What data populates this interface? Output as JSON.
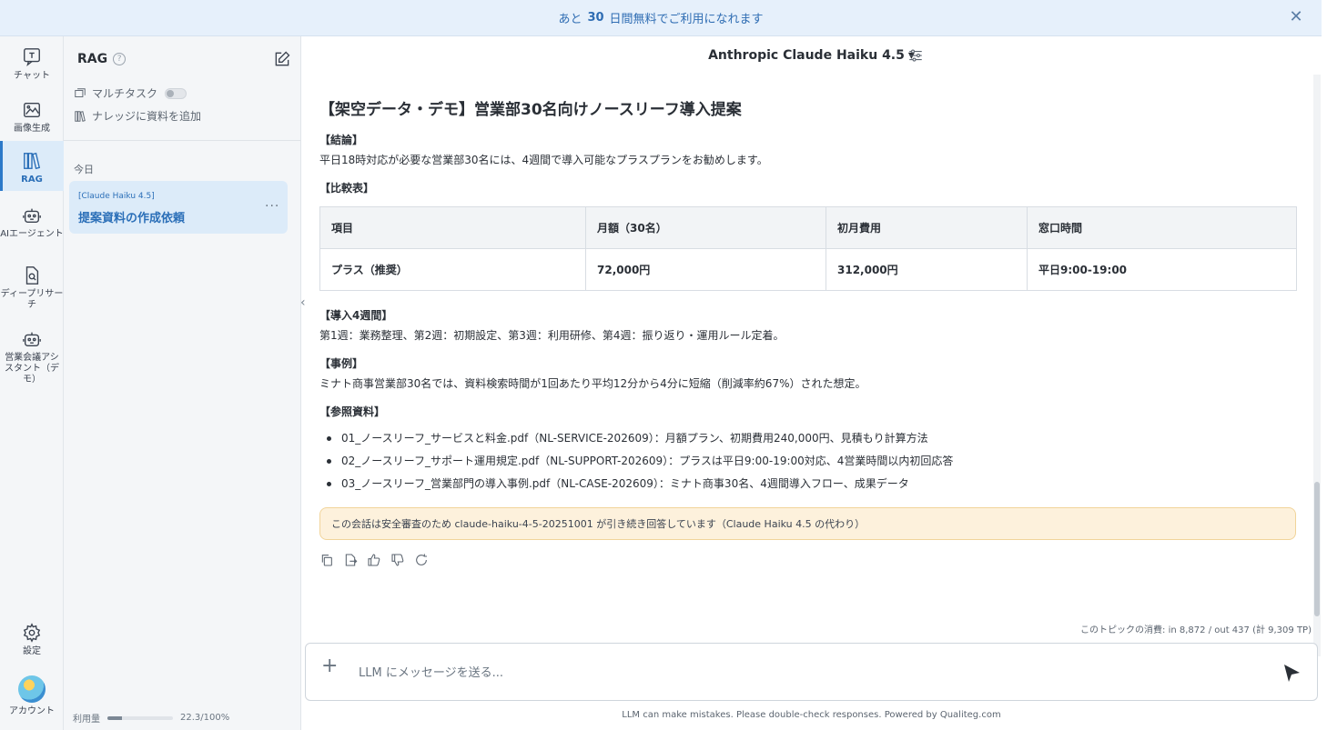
{
  "banner": {
    "prefix": "あと",
    "days": "30",
    "suffix": "日間無料でご利用になれます",
    "close": "✕"
  },
  "rail": {
    "items": [
      {
        "label": "チャット"
      },
      {
        "label": "画像生成"
      },
      {
        "label": "RAG"
      },
      {
        "label": "AIエージェント"
      },
      {
        "label": "ディープリサーチ"
      },
      {
        "label": "営業会議アシスタント（デモ）"
      },
      {
        "label": "設定"
      },
      {
        "label": "アカウント"
      }
    ]
  },
  "sidebar": {
    "title": "RAG",
    "help": "?",
    "multitask_label": "マルチタスク",
    "knowledge_label": "ナレッジに資料を追加",
    "section_today": "今日",
    "conversation": {
      "model": "[Claude Haiku 4.5]",
      "title": "提案資料の作成依頼",
      "more": "···"
    },
    "usage": {
      "label": "利用量",
      "value": "22.3/100%",
      "percent": 22.3
    }
  },
  "main": {
    "model": "Anthropic Claude Haiku 4.5",
    "model_caret": "▾",
    "collapse": "‹",
    "title": "【架空データ・デモ】営業部30名向けノースリーフ導入提案",
    "conclusion_head": "【結論】",
    "conclusion": "平日18時対応が必要な営業部30名には、4週間で導入可能なプラスプランをお勧めします。",
    "comparison_head": "【比較表】",
    "table": {
      "headers": [
        "項目",
        "月額（30名）",
        "初月費用",
        "窓口時間"
      ],
      "rows": [
        [
          "プラス（推奨）",
          "72,000円",
          "312,000円",
          "平日9:00-19:00"
        ]
      ]
    },
    "intro_head": "【導入4週間】",
    "intro": "第1週：業務整理、第2週：初期設定、第3週：利用研修、第4週：振り返り・運用ルール定着。",
    "case_head": "【事例】",
    "case": "ミナト商事営業部30名では、資料検索時間が1回あたり平均12分から4分に短縮（削減率約67%）された想定。",
    "refs_head": "【参照資料】",
    "refs": [
      "01_ノースリーフ_サービスと料金.pdf（NL-SERVICE-202609）：月額プラン、初期費用240,000円、見積もり計算方法",
      "02_ノースリーフ_サポート運用規定.pdf（NL-SUPPORT-202609）：プラスは平日9:00-19:00対応、4営業時間以内初回応答",
      "03_ノースリーフ_営業部門の導入事例.pdf（NL-CASE-202609）：ミナト商事30名、4週間導入フロー、成果データ"
    ],
    "notice": "この会話は安全審査のため claude-haiku-4-5-20251001 が引き続き回答しています（Claude Haiku 4.5 の代わり）",
    "tokens": "このトピックの消費: in 8,872 / out 437 (計 9,309 TP)",
    "input_placeholder": "LLM にメッセージを送る...",
    "plus": "+",
    "footer": "LLM can make mistakes. Please double-check responses. Powered by Qualiteg.com"
  },
  "colors": {
    "accent": "#2b79c9",
    "banner_bg": "#e6f0fb",
    "notice_bg": "#fdf1dc",
    "active_bg": "#dcebf9"
  }
}
